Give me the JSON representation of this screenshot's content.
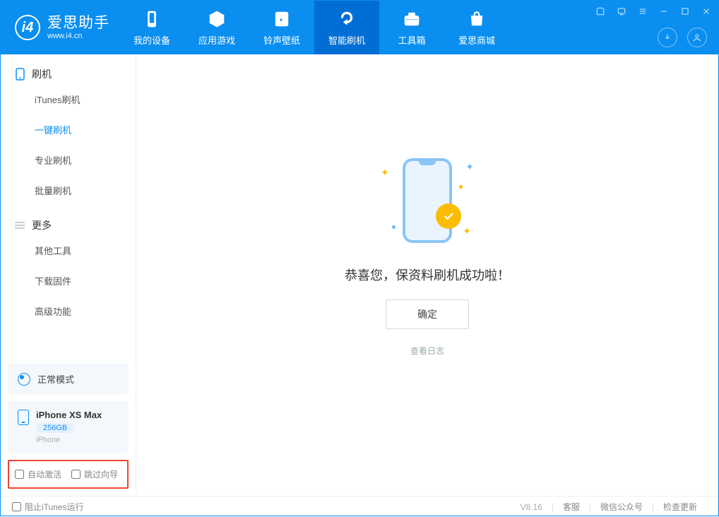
{
  "app": {
    "logo_title": "爱思助手",
    "logo_sub": "www.i4.cn"
  },
  "nav": [
    {
      "label": "我的设备",
      "icon": "device-icon"
    },
    {
      "label": "应用游戏",
      "icon": "cube-icon"
    },
    {
      "label": "铃声壁纸",
      "icon": "music-icon"
    },
    {
      "label": "智能刷机",
      "icon": "refresh-shield-icon",
      "active": true
    },
    {
      "label": "工具箱",
      "icon": "toolbox-icon"
    },
    {
      "label": "爱思商城",
      "icon": "store-icon"
    }
  ],
  "sidebar": {
    "group1_header": "刷机",
    "group1_icon": "phone-outline-icon",
    "group1_items": [
      {
        "label": "iTunes刷机"
      },
      {
        "label": "一键刷机",
        "active": true
      },
      {
        "label": "专业刷机"
      },
      {
        "label": "批量刷机"
      }
    ],
    "group2_header": "更多",
    "group2_icon": "menu-lines-icon",
    "group2_items": [
      {
        "label": "其他工具"
      },
      {
        "label": "下载固件"
      },
      {
        "label": "高级功能"
      }
    ]
  },
  "device": {
    "mode_label": "正常模式",
    "name": "iPhone XS Max",
    "storage": "256GB",
    "type": "iPhone"
  },
  "options": {
    "auto_activate": "自动激活",
    "skip_guide": "跳过向导"
  },
  "main": {
    "success_text": "恭喜您，保资料刷机成功啦！",
    "confirm_label": "确定",
    "view_log_label": "查看日志"
  },
  "footer": {
    "block_itunes": "阻止iTunes运行",
    "version": "V8.16",
    "support": "客服",
    "wechat": "微信公众号",
    "update": "检查更新"
  }
}
